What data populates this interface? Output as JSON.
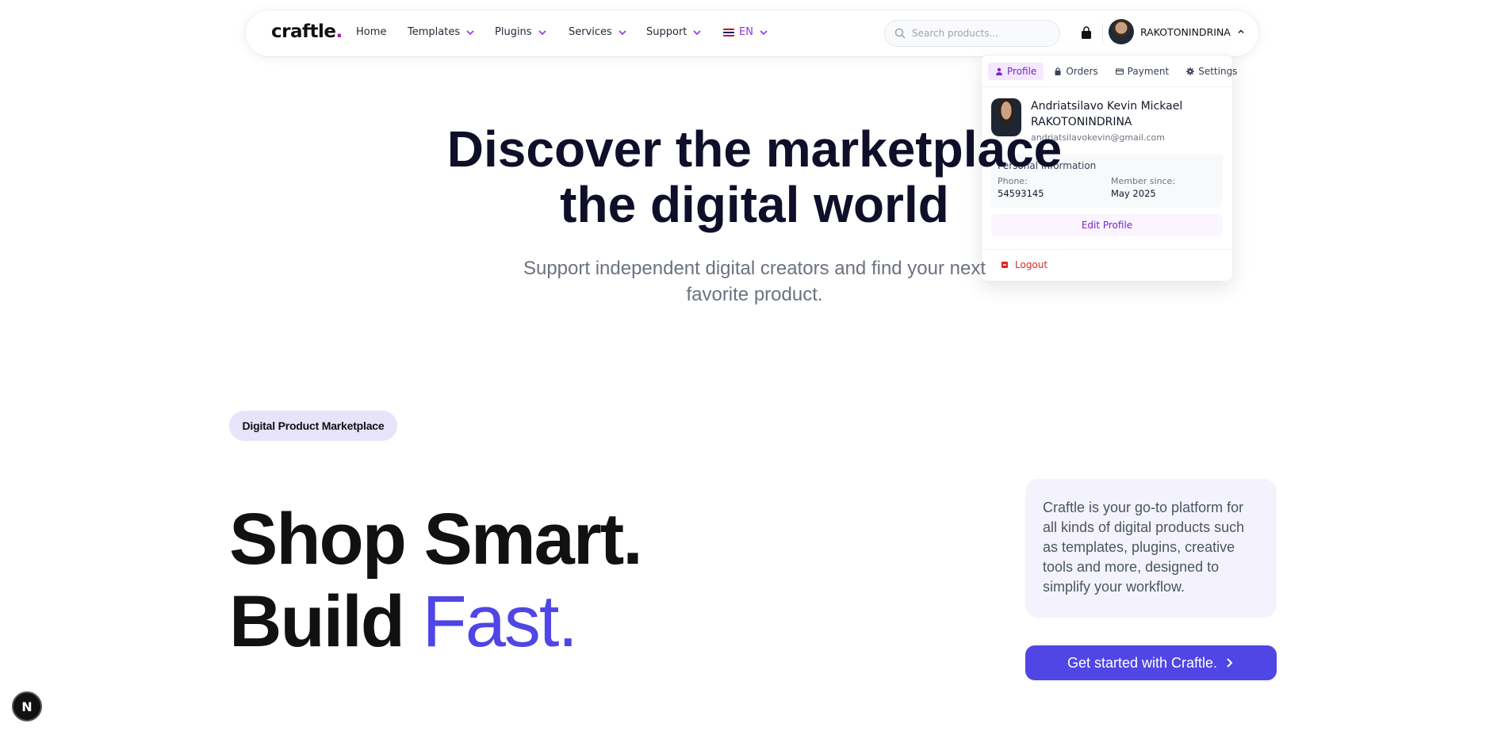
{
  "nav": {
    "logo": "craftle",
    "logo_dot": ".",
    "items": [
      {
        "label": "Home"
      },
      {
        "label": "Templates"
      },
      {
        "label": "Plugins"
      },
      {
        "label": "Services"
      },
      {
        "label": "Support"
      }
    ],
    "language": "EN",
    "search_placeholder": "Search products...",
    "user_name": "RAKOTONINDRINA"
  },
  "dropdown": {
    "tabs": [
      {
        "label": "Profile",
        "icon": "person-icon",
        "active": true
      },
      {
        "label": "Orders",
        "icon": "lock-icon"
      },
      {
        "label": "Payment",
        "icon": "card-icon"
      },
      {
        "label": "Settings",
        "icon": "gear-icon"
      }
    ],
    "full_name_first": "Andriatsilavo Kevin Mickael",
    "full_name_last": "RAKOTONINDRINA",
    "email": "andriatsilavokevin@gmail.com",
    "personal_info_title": "Personal Information",
    "phone_label": "Phone:",
    "phone_value": "54593145",
    "member_label": "Member since:",
    "member_value": "May 2025",
    "edit_label": "Edit Profile",
    "logout_label": "Logout"
  },
  "hero": {
    "title_line1": "Discover the marketplace",
    "title_line2": "the digital world",
    "subtitle_line1": "Support independent digital creators and find your next",
    "subtitle_line2": "favorite product."
  },
  "section": {
    "badge": "Digital Product Marketplace",
    "headline_line1": "Shop Smart.",
    "headline_word": "Build",
    "headline_accent": "Fast.",
    "description": "Craftle is your go-to platform for all kinds of digital products such as templates, plugins, creative tools and more, designed to simplify your workflow.",
    "cta_label": "Get started with Craftle."
  },
  "dev_badge": "N",
  "colors": {
    "accent": "#4f46e5",
    "purple": "#9333ea",
    "logout": "#dc2626"
  }
}
